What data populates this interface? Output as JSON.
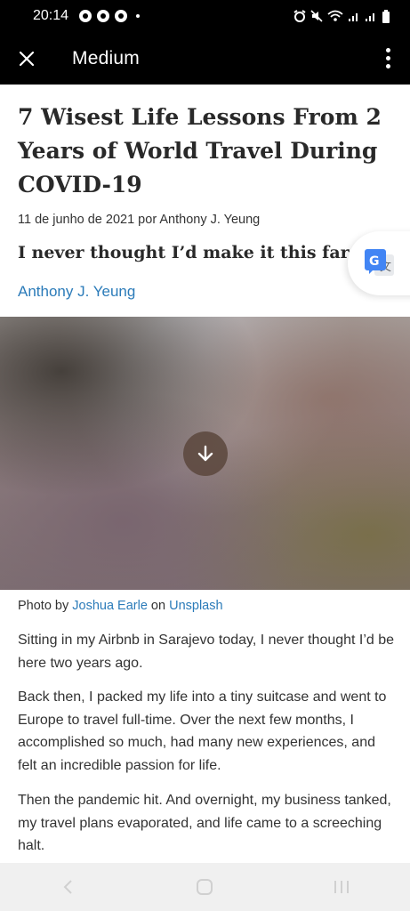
{
  "status_bar": {
    "time": "20:14",
    "left_icons": [
      "chrome-icon",
      "settings-app-icon",
      "facebook-icon"
    ],
    "right_icons": [
      "alarm-icon",
      "mute-icon",
      "wifi-icon",
      "signal-icon",
      "signal-icon",
      "battery-icon"
    ]
  },
  "app_bar": {
    "title": "Medium",
    "close_icon": "close-icon",
    "menu_icon": "more-vert-icon"
  },
  "article": {
    "title": "7 Wisest Life Lessons From 2 Years of World Travel During COVID-19",
    "meta": "11 de junho de 2021 por Anthony J. Yeung",
    "subtitle": "I never thought I’d make it this far.",
    "author": "Anthony J. Yeung",
    "photo_caption": {
      "prefix": "Photo by ",
      "photographer": "Joshua Earle",
      "middle": " on ",
      "source": "Unsplash"
    },
    "paragraphs": [
      "Sitting in my Airbnb in Sarajevo today, I never thought I’d be here two years ago.",
      "Back then, I packed my life into a tiny suitcase and went to Europe to travel full-time. Over the next few months, I accomplished so much, had many new experiences, and felt an incredible passion for life.",
      "Then the pandemic hit. And overnight, my business tanked, my travel plans evaporated, and life came to a screeching halt."
    ]
  },
  "colors": {
    "link": "#2b7bb9",
    "text": "#333333",
    "title": "#292929",
    "bar": "#000000"
  }
}
